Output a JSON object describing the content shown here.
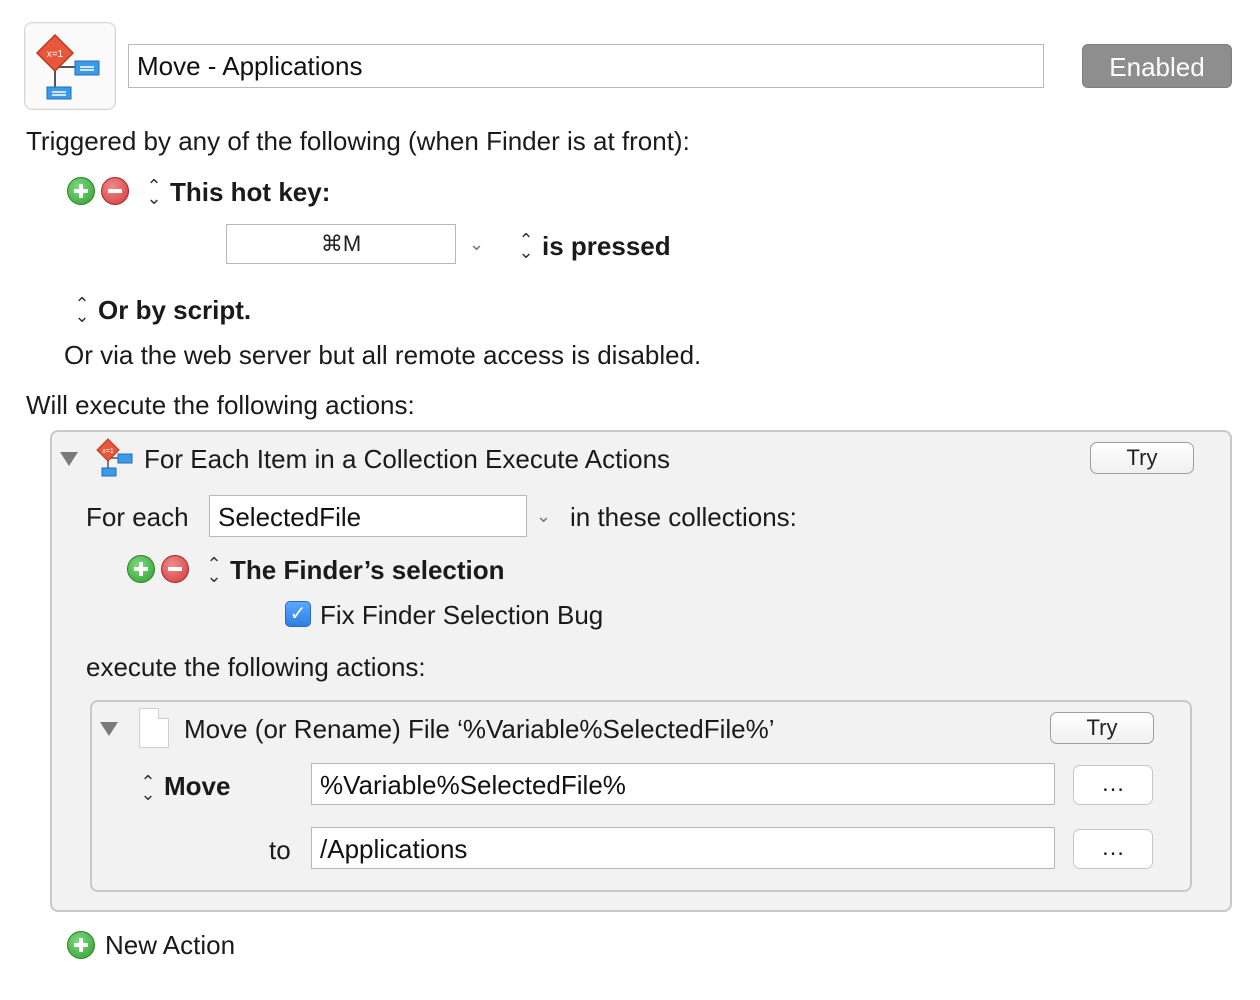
{
  "macro": {
    "icon": "flowchart-macro-icon",
    "name": "Move - Applications",
    "enabled_label": "Enabled"
  },
  "triggers": {
    "header": "Triggered by any of the following (when Finder is at front):",
    "hotkey_label": "This hot key:",
    "hotkey_value": "⌘M",
    "hotkey_condition": "is pressed",
    "script_label": "Or by script.",
    "web_server_text": "Or via the web server but all remote access is disabled."
  },
  "actions_header": "Will execute the following actions:",
  "for_each_action": {
    "title": "For Each Item in a Collection Execute Actions",
    "try_label": "Try",
    "for_each_label": "For each",
    "variable_value": "SelectedFile",
    "collections_label": "in these collections:",
    "collection_source": "The Finder’s selection",
    "fix_bug_label": "Fix Finder Selection Bug",
    "fix_bug_checked": true,
    "execute_label": "execute the following actions:",
    "move_action": {
      "title": "Move (or Rename) File ‘%Variable%SelectedFile%’",
      "try_label": "Try",
      "move_label": "Move",
      "source_value": "%Variable%SelectedFile%",
      "to_label": "to",
      "dest_value": "/Applications",
      "browse_label": "…"
    }
  },
  "new_action_label": "New Action",
  "colors": {
    "enabled_bg": "#8e8e8e",
    "add_green": "#2f9e2f",
    "remove_red": "#d23a3a",
    "checkbox_blue": "#2d7fe3"
  }
}
